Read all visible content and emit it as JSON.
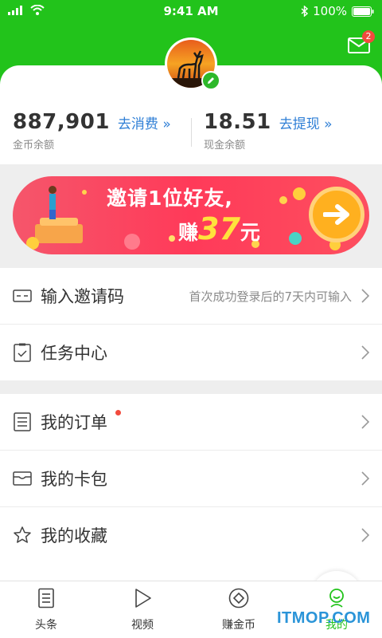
{
  "status_bar": {
    "time": "9:41 AM",
    "battery": "100%"
  },
  "header": {
    "mail_badge": "2"
  },
  "balances": {
    "coins": {
      "value": "887,901",
      "label": "金币余额",
      "link": "去消费 »"
    },
    "cash": {
      "value": "18.51",
      "label": "现金余额",
      "link": "去提现 »"
    }
  },
  "banner": {
    "line1": "邀请1位好友,",
    "line2_prefix": "赚",
    "line2_amount": "37",
    "line2_suffix": "元"
  },
  "menu": {
    "invite_code": {
      "label": "输入邀请码",
      "hint": "首次成功登录后的7天内可输入"
    },
    "task_center": {
      "label": "任务中心"
    },
    "orders": {
      "label": "我的订单"
    },
    "card_wallet": {
      "label": "我的卡包"
    },
    "favorites": {
      "label": "我的收藏"
    }
  },
  "tabs": [
    {
      "label": "头条",
      "icon": "news-icon"
    },
    {
      "label": "视频",
      "icon": "play-icon"
    },
    {
      "label": "赚金币",
      "icon": "coin-icon"
    },
    {
      "label": "我的",
      "icon": "profile-icon"
    }
  ],
  "colors": {
    "brand_green": "#22c31b",
    "link_blue": "#2f7fd6",
    "badge_red": "#f24a3d"
  },
  "watermark": "ITMOP.COM"
}
